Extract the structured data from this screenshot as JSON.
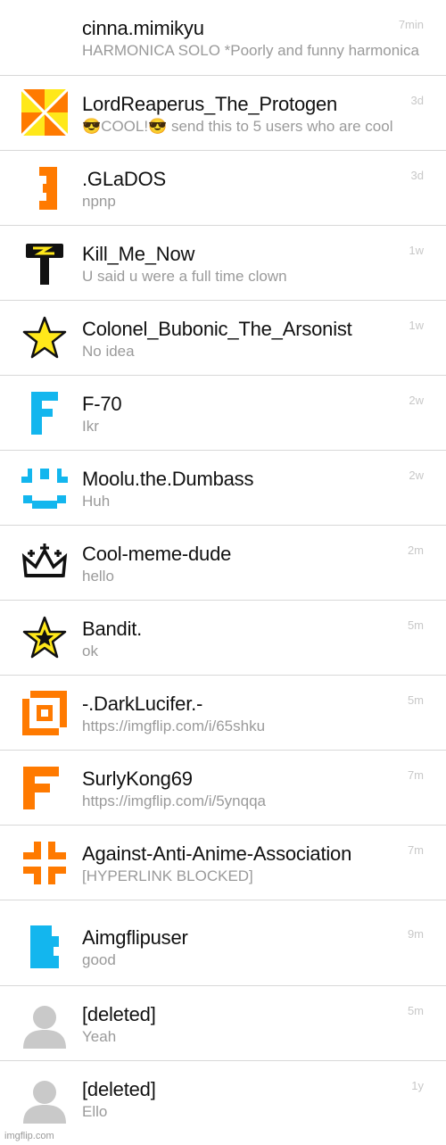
{
  "conversations": [
    {
      "name": "cinna.mimikyu",
      "message": "HARMONICA SOLO *Poorly and funny harmonica",
      "time": "7min",
      "avatar_icon": "none"
    },
    {
      "name": "LordReaperus_The_Protogen",
      "message": "😎COOL!😎 send this to 5 users who are cool",
      "time": "3d",
      "avatar_icon": "pinwheel-icon"
    },
    {
      "name": ".GLaDOS",
      "message": "npnp",
      "time": "3d",
      "avatar_icon": "orange-block-glyph-icon"
    },
    {
      "name": "Kill_Me_Now",
      "message": "U said u were a full time clown",
      "time": "1w",
      "avatar_icon": "hammer-lightning-icon"
    },
    {
      "name": "Colonel_Bubonic_The_Arsonist",
      "message": "No idea",
      "time": "1w",
      "avatar_icon": "yellow-star-icon"
    },
    {
      "name": "F-70",
      "message": "Ikr",
      "time": "2w",
      "avatar_icon": "blue-f-letter-icon"
    },
    {
      "name": "Moolu.the.Dumbass",
      "message": "Huh",
      "time": "2w",
      "avatar_icon": "smile-brackets-icon"
    },
    {
      "name": "Cool-meme-dude",
      "message": "hello",
      "time": "2m",
      "avatar_icon": "crown-icon"
    },
    {
      "name": "Bandit.",
      "message": "ok",
      "time": "5m",
      "avatar_icon": "star-in-star-icon"
    },
    {
      "name": "-.DarkLucifer.-",
      "message": "https://imgflip.com/i/65shku",
      "time": "5m",
      "avatar_icon": "orange-ring-icon"
    },
    {
      "name": "SurlyKong69",
      "message": "https://imgflip.com/i/5ynqqa",
      "time": "7m",
      "avatar_icon": "orange-f-letter-icon"
    },
    {
      "name": "Against-Anti-Anime-Association",
      "message": "[HYPERLINK BLOCKED]",
      "time": "7m",
      "avatar_icon": "orange-corners-icon"
    },
    {
      "name": "Aimgflipuser",
      "message": "good",
      "time": "9m",
      "avatar_icon": "blue-puzzle-icon"
    },
    {
      "name": "[deleted]",
      "message": "Yeah",
      "time": "5m",
      "avatar_icon": "default-user-icon"
    },
    {
      "name": "[deleted]",
      "message": "Ello",
      "time": "1y",
      "avatar_icon": "default-user-icon"
    }
  ],
  "watermark": "imgflip.com",
  "colors": {
    "orange": "#ff7a00",
    "blue": "#13b6ee",
    "yellow": "#ffe81a",
    "grey": "#c9c9c9"
  }
}
